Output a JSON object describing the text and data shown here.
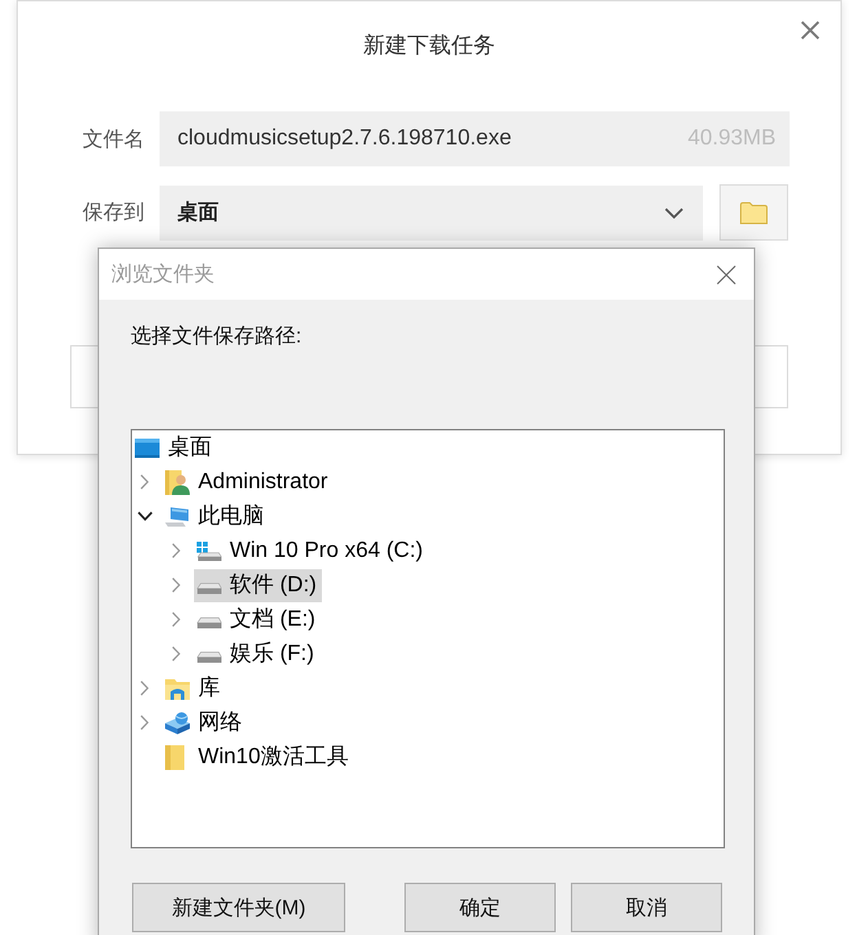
{
  "download_dialog": {
    "title": "新建下载任务",
    "file_name": {
      "label": "文件名",
      "value": "cloudmusicsetup2.7.6.198710.exe",
      "size": "40.93MB"
    },
    "save_to": {
      "label": "保存到",
      "value": "桌面"
    }
  },
  "browse_dialog": {
    "title": "浏览文件夹",
    "prompt": "选择文件保存路径:",
    "tree": [
      {
        "label": "桌面",
        "kind": "desktop",
        "expandable": false,
        "expanded": true,
        "selected": false,
        "children": [
          {
            "label": "Administrator",
            "kind": "user",
            "expandable": true,
            "expanded": false,
            "selected": false
          },
          {
            "label": "此电脑",
            "kind": "computer",
            "expandable": true,
            "expanded": true,
            "selected": false,
            "children": [
              {
                "label": "Win 10 Pro x64 (C:)",
                "kind": "system-drive",
                "expandable": true,
                "expanded": false,
                "selected": false
              },
              {
                "label": "软件 (D:)",
                "kind": "drive",
                "expandable": true,
                "expanded": false,
                "selected": true
              },
              {
                "label": "文档 (E:)",
                "kind": "drive",
                "expandable": true,
                "expanded": false,
                "selected": false
              },
              {
                "label": "娱乐 (F:)",
                "kind": "drive",
                "expandable": true,
                "expanded": false,
                "selected": false
              }
            ]
          },
          {
            "label": "库",
            "kind": "library",
            "expandable": true,
            "expanded": false,
            "selected": false
          },
          {
            "label": "网络",
            "kind": "network",
            "expandable": true,
            "expanded": false,
            "selected": false
          },
          {
            "label": "Win10激活工具",
            "kind": "folder",
            "expandable": false,
            "selected": false
          }
        ]
      }
    ],
    "buttons": [
      "新建文件夹(M)",
      "确定",
      "取消"
    ]
  }
}
